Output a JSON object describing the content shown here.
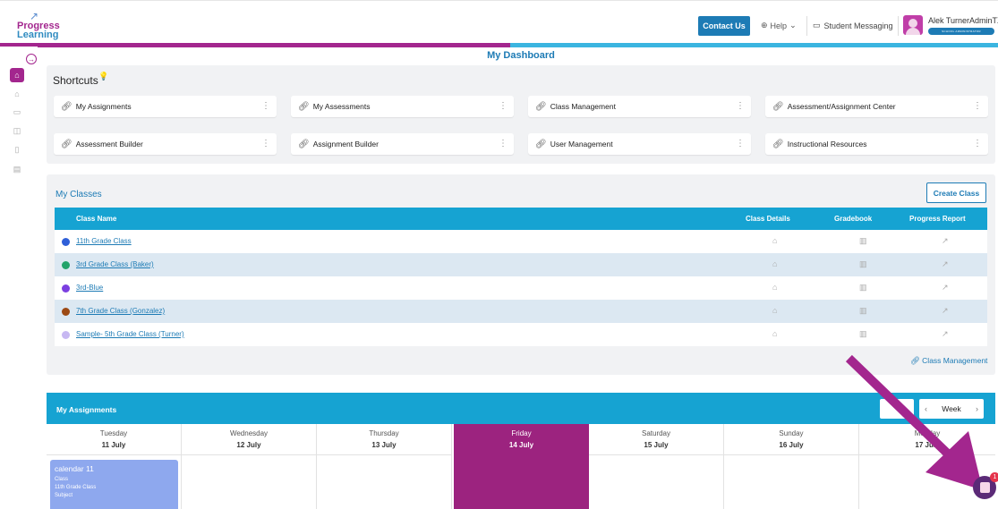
{
  "logo": {
    "line1": "Progress",
    "line2": "Learning"
  },
  "header": {
    "contact": "Contact Us",
    "help": "Help",
    "messaging": "Student Messaging",
    "user_name": "Alek TurnerAdminTX",
    "user_role": "SCHOOL ADMINISTRATOR"
  },
  "sidebar": {
    "icons": [
      "home-icon",
      "school-icon",
      "monitor-icon",
      "book-icon",
      "library-icon",
      "document-icon"
    ]
  },
  "dashboard_title": "My Dashboard",
  "shortcuts": {
    "title": "Shortcuts",
    "items": [
      "My Assignments",
      "My Assessments",
      "Class Management",
      "Assessment/Assignment Center",
      "Assessment Builder",
      "Assignment Builder",
      "User Management",
      "Instructional Resources"
    ]
  },
  "classes": {
    "title": "My Classes",
    "create_label": "Create Class",
    "columns": [
      "Class Name",
      "Class Details",
      "Gradebook",
      "Progress Report"
    ],
    "rows": [
      {
        "name": "11th Grade Class",
        "color": "#2f5fd8"
      },
      {
        "name": "3rd Grade Class (Baker)",
        "color": "#23a36b"
      },
      {
        "name": "3rd-Blue",
        "color": "#7b3fe0"
      },
      {
        "name": "7th Grade Class (Gonzalez)",
        "color": "#9c4a14"
      },
      {
        "name": "Sample- 5th Grade Class (Turner)",
        "color": "#c7b8f2"
      }
    ],
    "management_link": "Class Management"
  },
  "assignments": {
    "title": "My Assignments",
    "view_label": "Week",
    "days": [
      {
        "name": "Tuesday",
        "date": "11 July"
      },
      {
        "name": "Wednesday",
        "date": "12 July"
      },
      {
        "name": "Thursday",
        "date": "13 July"
      },
      {
        "name": "Friday",
        "date": "14 July"
      },
      {
        "name": "Saturday",
        "date": "15 July"
      },
      {
        "name": "Sunday",
        "date": "16 July"
      },
      {
        "name": "Monday",
        "date": "17 July"
      }
    ],
    "event": {
      "title": "calendar 11",
      "line1": "Class",
      "line2": "11th Grade Class",
      "line3": "Subject"
    }
  },
  "chat_badge": "1",
  "colors": {
    "brand_pink": "#a3268e",
    "brand_blue": "#1d7bb5",
    "header_blue": "#16a3d2",
    "arrow": "#a3268e"
  }
}
